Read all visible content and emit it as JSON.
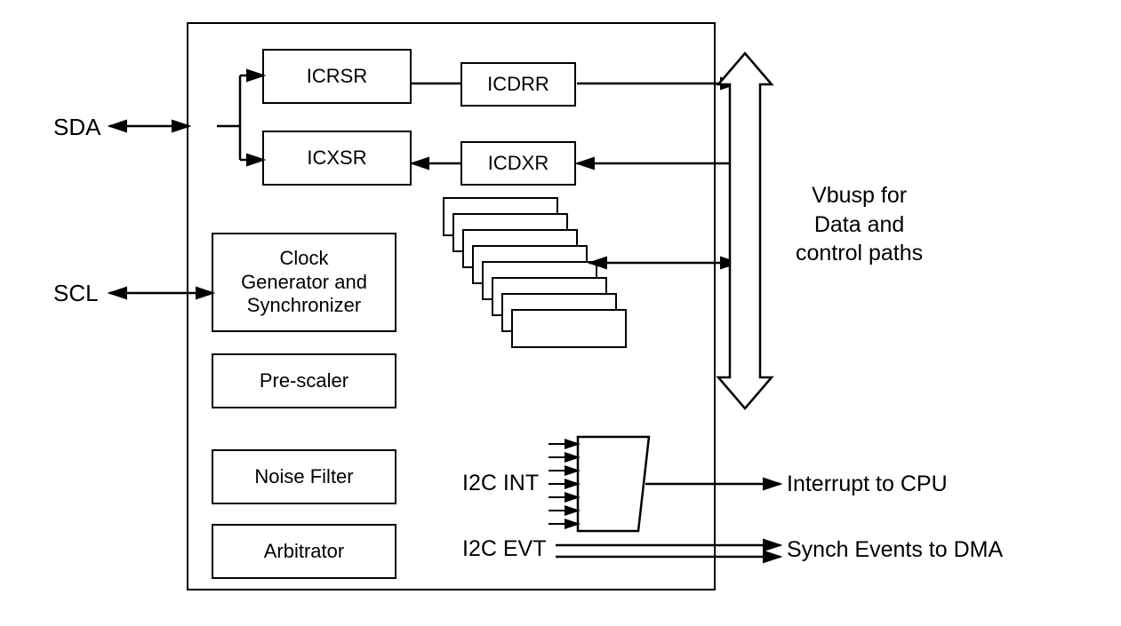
{
  "signals": {
    "sda": "SDA",
    "scl": "SCL"
  },
  "main_blocks": {
    "icrsr": "ICRSR",
    "icdrr": "ICDRR",
    "icxsr": "ICXSR",
    "icdxr": "ICDXR",
    "clock": "Clock\nGenerator and\nSynchronizer",
    "prescaler": "Pre-scaler",
    "noise_filter": "Noise Filter",
    "arbitrator": "Arbitrator"
  },
  "labels": {
    "vbusp": "Vbusp for\nData and\ncontrol paths",
    "i2c_int": "I2C INT",
    "i2c_evt": "I2C EVT",
    "interrupt_cpu": "Interrupt to CPU",
    "synch_dma": "Synch Events to DMA"
  }
}
